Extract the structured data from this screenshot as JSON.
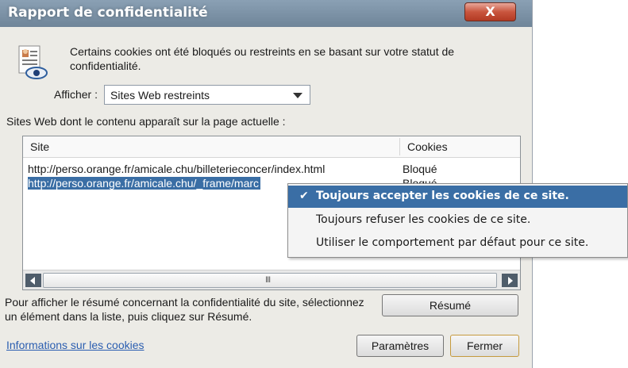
{
  "window": {
    "title": "Rapport de confidentialité",
    "close_glyph": "X"
  },
  "intro": {
    "text": "Certains cookies ont été bloqués ou restreints en se basant sur votre statut de confidentialité."
  },
  "filter": {
    "label": "Afficher :",
    "selected": "Sites Web restreints"
  },
  "list": {
    "caption": "Sites Web dont le contenu apparaît sur la page actuelle :",
    "columns": [
      "Site",
      "Cookies"
    ],
    "rows": [
      {
        "site": "http://perso.orange.fr/amicale.chu/billeterieconcer/index.html",
        "cookies": "Bloqué"
      },
      {
        "site": "http://perso.orange.fr/amicale.chu/_frame/marc",
        "cookies": "Bloqué"
      }
    ],
    "scroll_grip": "III"
  },
  "context_menu": {
    "items": [
      {
        "label": "Toujours accepter les cookies de ce site.",
        "checked": true
      },
      {
        "label": "Toujours refuser les cookies de ce site.",
        "checked": false
      },
      {
        "label": "Utiliser le comportement par défaut pour ce site.",
        "checked": false
      }
    ],
    "check_glyph": "✔"
  },
  "footer": {
    "hint": "Pour afficher le résumé concernant la confidentialité du site, sélectionnez un élément dans la liste, puis cliquez sur Résumé.",
    "summary_button": "Résumé",
    "cookies_link": "Informations sur les cookies",
    "settings_button": "Paramètres",
    "close_button": "Fermer"
  },
  "colors": {
    "titlebar": "#7a90a5",
    "selection": "#3a6ea5",
    "close_button": "#c9553e",
    "link": "#2a5db0"
  },
  "icons": [
    "privacy-report-icon",
    "close-icon",
    "dropdown-arrow-icon",
    "scroll-left-icon",
    "scroll-right-icon",
    "checkmark-icon"
  ]
}
